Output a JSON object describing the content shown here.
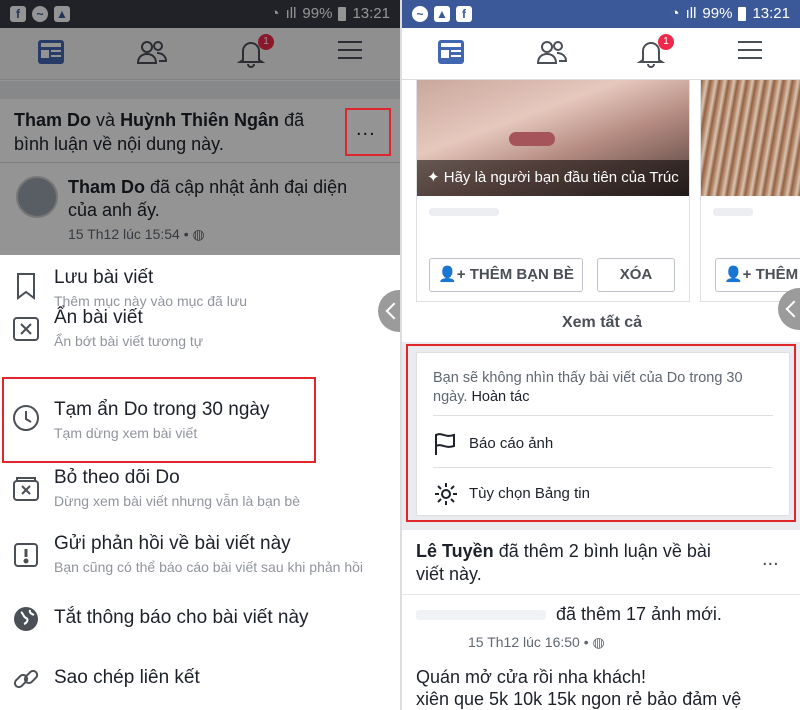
{
  "status_bar": {
    "battery": "99%",
    "time": "13:21"
  },
  "left": {
    "notif_badge": "1",
    "post_header": {
      "name1": "Tham Do",
      "conj": "và",
      "name2": "Huỳnh Thiên Ngân",
      "rest_line1": "đã",
      "line2": "bình luận về nội dung này."
    },
    "more_label": "...",
    "story": {
      "author": "Tham Do",
      "text1": "đã cập nhật ảnh đại diện",
      "text2": "của anh ấy.",
      "time": "15 Th12 lúc 15:54 •"
    },
    "menu": [
      {
        "title": "Lưu bài viết",
        "subtitle": "Thêm mục này vào mục đã lưu",
        "icon": "bookmark-icon"
      },
      {
        "title": "Ẩn bài viết",
        "subtitle": "Ẩn bớt bài viết tương tự",
        "icon": "hide-x-icon"
      },
      {
        "title": "Tạm ẩn Do trong 30 ngày",
        "subtitle": "Tạm dừng xem bài viết",
        "icon": "clock-icon"
      },
      {
        "title": "Bỏ theo dõi Do",
        "subtitle": "Dừng xem bài viết nhưng vẫn là bạn bè",
        "icon": "unfollow-icon"
      },
      {
        "title": "Gửi phản hồi về bài viết này",
        "subtitle": "Bạn cũng có thể báo cáo bài viết sau khi phản hồi",
        "icon": "feedback-icon"
      },
      {
        "title": "Tắt thông báo cho bài viết này",
        "subtitle": "",
        "icon": "globe-icon"
      },
      {
        "title": "Sao chép liên kết",
        "subtitle": "",
        "icon": "link-icon"
      }
    ]
  },
  "right": {
    "notif_badge": "1",
    "suggestion_caption": "Hãy là người bạn đầu tiên của Trúc",
    "add_friend_label": "THÊM BẠN BÈ",
    "remove_label": "XÓA",
    "add_friend_label_2": "THÊM",
    "see_all": "Xem tất cả",
    "hidden_notice": {
      "line1": "Bạn sẽ không nhìn thấy bài viết của Do trong 30",
      "line2": "ngày.",
      "undo": "Hoàn tác"
    },
    "options": [
      {
        "label": "Báo cáo ảnh",
        "icon": "flag-icon"
      },
      {
        "label": "Tùy chọn Bảng tin",
        "icon": "gear-icon"
      }
    ],
    "next_post": {
      "author": "Lê Tuyền",
      "text1": "đã thêm 2 bình luận về bài",
      "text2": "viết này.",
      "more": "...",
      "sub_text": "đã thêm 17 ảnh mới.",
      "time": "15 Th12 lúc 16:50 •",
      "body1": "Quán mở cửa rồi nha khách!",
      "body2": "xiên que 5k 10k 15k ngon rẻ bảo đảm vệ"
    }
  },
  "colors": {
    "status_left": "#3a3c44",
    "status_right": "#3b5998",
    "accent": "#4267b2",
    "highlight": "#e0252b"
  }
}
